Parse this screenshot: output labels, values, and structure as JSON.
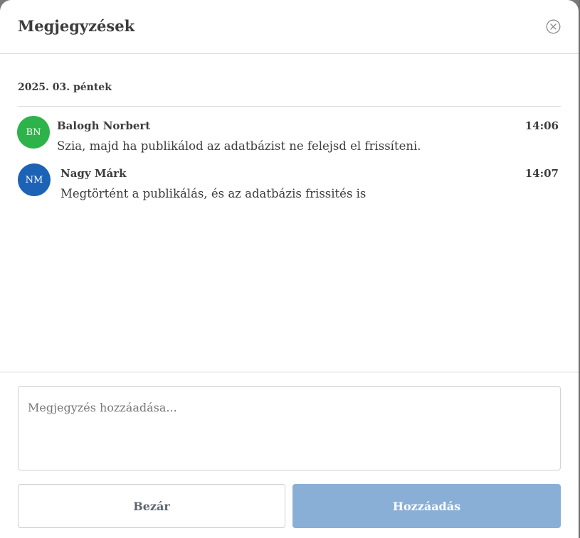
{
  "dialog": {
    "title": "Megjegyzések",
    "close_icon": "close-circle-icon"
  },
  "date_group": "2025. 03. péntek",
  "messages": [
    {
      "initials": "BN",
      "author": "Balogh Norbert",
      "time": "14:06",
      "text": "Szia, majd ha publikálod az adatbázist ne felejsd el frissíteni.",
      "avatar_color": "#2db34a"
    },
    {
      "initials": "NM",
      "author": "Nagy Márk",
      "time": "14:07",
      "text": "Megtörtént a publikálás, és az adatbázis frissités is",
      "avatar_color": "#1c63b7"
    }
  ],
  "input": {
    "placeholder": "Megjegyzés hozzáadása...",
    "value": ""
  },
  "buttons": {
    "close_label": "Bezár",
    "add_label": "Hozzáadás"
  },
  "colors": {
    "primary_disabled": "#8aafd6"
  }
}
